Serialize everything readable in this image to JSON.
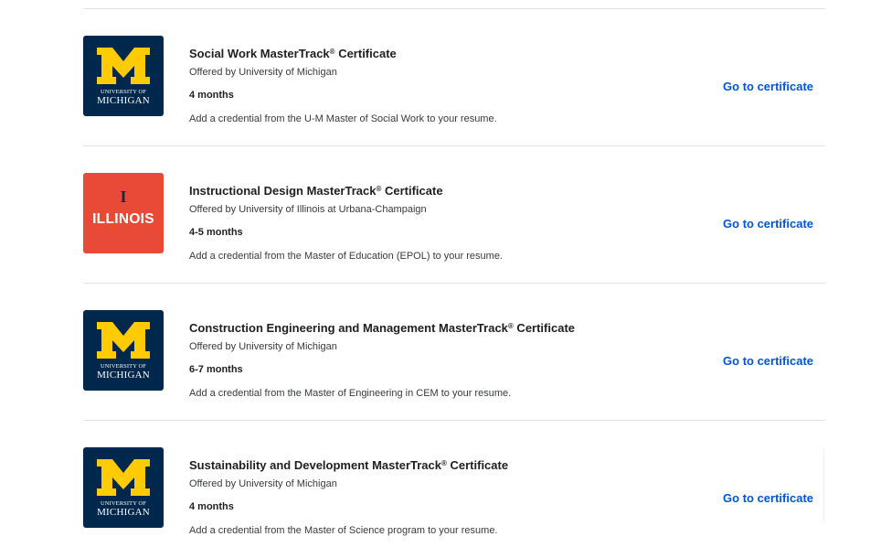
{
  "colors": {
    "michigan_blue": "#00274c",
    "michigan_maize": "#ffcb05",
    "illinois_orange": "#e84a37",
    "illinois_blue": "#13294b",
    "link_blue": "#0056d2"
  },
  "certificates": [
    {
      "logo": "michigan",
      "logo_line1": "UNIVERSITY OF",
      "logo_line2": "MICHIGAN",
      "title": "Social Work MasterTrack",
      "title_mark": "®",
      "title_suffix": " Certificate",
      "offered_by": "Offered by University of Michigan",
      "duration": "4 months",
      "description": "Add a credential from the U-M Master of Social Work to your resume.",
      "cta": "Go to certificate"
    },
    {
      "logo": "illinois",
      "logo_mark": "I",
      "logo_line1": "ILLINOIS",
      "title": "Instructional Design MasterTrack",
      "title_mark": "®",
      "title_suffix": " Certificate",
      "offered_by": "Offered by University of Illinois at Urbana-Champaign",
      "duration": "4-5 months",
      "description": "Add a credential from the Master of Education (EPOL) to your resume.",
      "cta": "Go to certificate"
    },
    {
      "logo": "michigan",
      "logo_line1": "UNIVERSITY OF",
      "logo_line2": "MICHIGAN",
      "title": "Construction Engineering and Management MasterTrack",
      "title_mark": "®",
      "title_suffix": " Certificate",
      "offered_by": "Offered by University of Michigan",
      "duration": "6-7 months",
      "description": "Add a credential from the Master of Engineering in CEM to your resume.",
      "cta": "Go to certificate"
    },
    {
      "logo": "michigan",
      "logo_line1": "UNIVERSITY OF",
      "logo_line2": "MICHIGAN",
      "title": "Sustainability and Development MasterTrack",
      "title_mark": "®",
      "title_suffix": " Certificate",
      "offered_by": "Offered by University of Michigan",
      "duration": "4 months",
      "description": "Add a credential from the Master of Science program to your resume.",
      "cta": "Go to certificate"
    }
  ]
}
